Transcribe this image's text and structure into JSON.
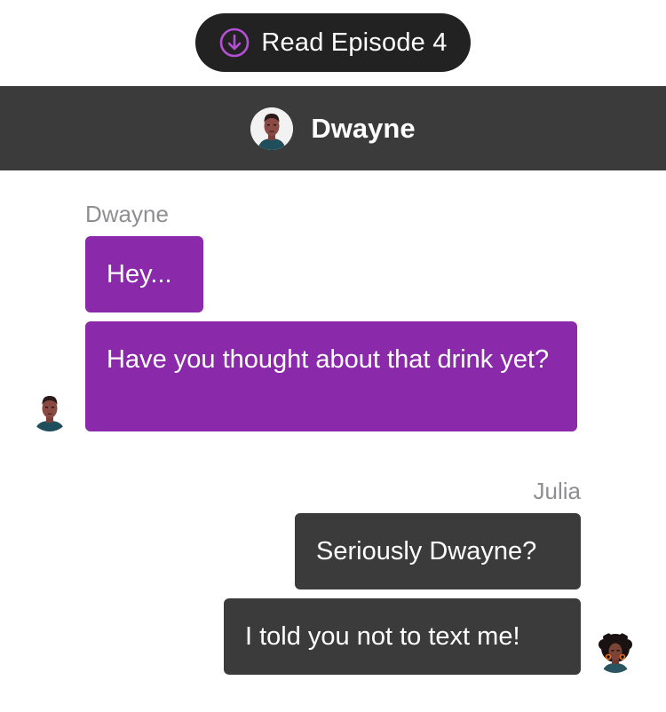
{
  "top_pill": {
    "label": "Read Episode 4",
    "icon": "download-circle-icon",
    "icon_color": "#b44fd6"
  },
  "header": {
    "contact_name": "Dwayne",
    "avatar": "dwayne-avatar"
  },
  "colors": {
    "incoming_bubble": "#8a2aab",
    "outgoing_bubble": "#3b3b3b",
    "header_bg": "#3b3b3b",
    "pill_bg": "#222222",
    "sender_label": "#8e8e93"
  },
  "conversation": {
    "groups": [
      {
        "sender": "Dwayne",
        "side": "left",
        "messages": [
          {
            "text": "Hey..."
          },
          {
            "text": "Have you thought about that drink yet?"
          }
        ]
      },
      {
        "sender": "Julia",
        "side": "right",
        "messages": [
          {
            "text": "Seriously Dwayne?"
          },
          {
            "text": "I told you not to text me!"
          }
        ]
      }
    ]
  }
}
